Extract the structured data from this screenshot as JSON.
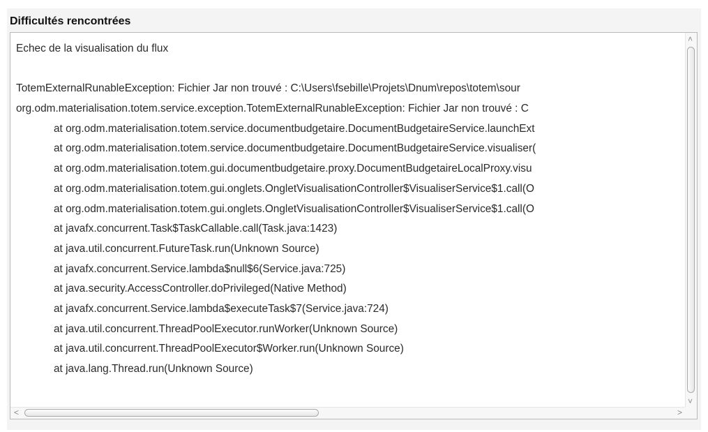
{
  "section": {
    "title": "Difficultés rencontrées"
  },
  "log": {
    "lines": [
      {
        "text": "Echec de la visualisation du flux",
        "indent": false
      },
      {
        "text": "",
        "indent": false
      },
      {
        "text": "TotemExternalRunableException: Fichier Jar non trouvé : C:\\Users\\fsebille\\Projets\\Dnum\\repos\\totem\\sour",
        "indent": false
      },
      {
        "text": "org.odm.materialisation.totem.service.exception.TotemExternalRunableException: Fichier Jar non trouvé : C",
        "indent": false
      },
      {
        "text": "at org.odm.materialisation.totem.service.documentbudgetaire.DocumentBudgetaireService.launchExt",
        "indent": true
      },
      {
        "text": "at org.odm.materialisation.totem.service.documentbudgetaire.DocumentBudgetaireService.visualiser(",
        "indent": true
      },
      {
        "text": "at org.odm.materialisation.totem.gui.documentbudgetaire.proxy.DocumentBudgetaireLocalProxy.visu",
        "indent": true
      },
      {
        "text": "at org.odm.materialisation.totem.gui.onglets.OngletVisualisationController$VisualiserService$1.call(O",
        "indent": true
      },
      {
        "text": "at org.odm.materialisation.totem.gui.onglets.OngletVisualisationController$VisualiserService$1.call(O",
        "indent": true
      },
      {
        "text": "at javafx.concurrent.Task$TaskCallable.call(Task.java:1423)",
        "indent": true
      },
      {
        "text": "at java.util.concurrent.FutureTask.run(Unknown Source)",
        "indent": true
      },
      {
        "text": "at javafx.concurrent.Service.lambda$null$6(Service.java:725)",
        "indent": true
      },
      {
        "text": "at java.security.AccessController.doPrivileged(Native Method)",
        "indent": true
      },
      {
        "text": "at javafx.concurrent.Service.lambda$executeTask$7(Service.java:724)",
        "indent": true
      },
      {
        "text": "at java.util.concurrent.ThreadPoolExecutor.runWorker(Unknown Source)",
        "indent": true
      },
      {
        "text": "at java.util.concurrent.ThreadPoolExecutor$Worker.run(Unknown Source)",
        "indent": true
      },
      {
        "text": "at java.lang.Thread.run(Unknown Source)",
        "indent": true
      }
    ]
  },
  "scrollbars": {
    "arrow_up": "˄",
    "arrow_down": "˅",
    "arrow_left": "<",
    "arrow_right": ">"
  },
  "colors": {
    "panel_background": "#f4f4f4",
    "text_color": "#2b2b2b",
    "border_color": "#b9b9b9"
  }
}
